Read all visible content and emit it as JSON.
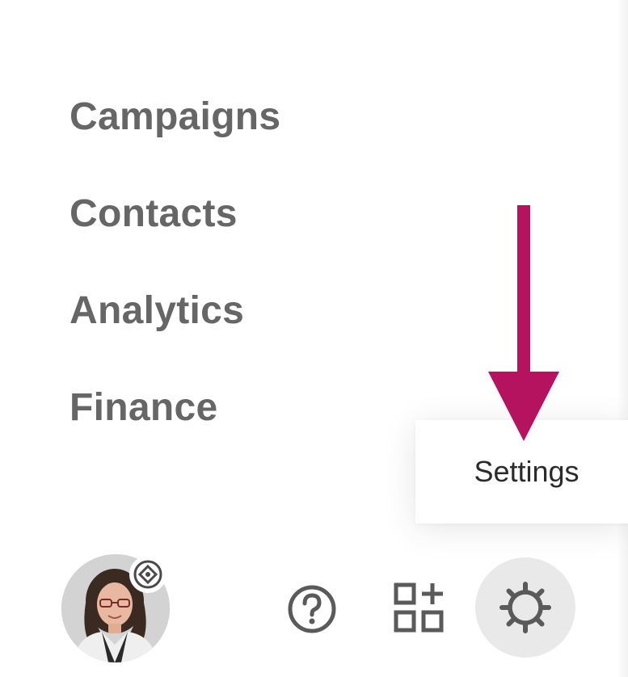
{
  "nav": {
    "items": [
      {
        "label": "Campaigns"
      },
      {
        "label": "Contacts"
      },
      {
        "label": "Analytics"
      },
      {
        "label": "Finance"
      }
    ]
  },
  "tooltip": {
    "label": "Settings"
  },
  "toolbar": {
    "help_icon": "help-circle-icon",
    "apps_icon": "add-apps-grid-icon",
    "settings_icon": "gear-icon"
  },
  "avatar": {
    "badge_icon": "account-badge-icon"
  },
  "colors": {
    "nav_text": "#666666",
    "arrow": "#b5135f",
    "settings_bg": "#e9e9e9",
    "icon": "#5a5a5a"
  }
}
